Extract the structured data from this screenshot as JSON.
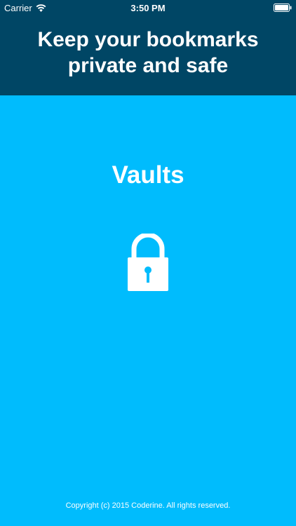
{
  "status_bar": {
    "carrier": "Carrier",
    "time": "3:50 PM"
  },
  "header": {
    "title": "Keep your bookmarks private and safe"
  },
  "main": {
    "title": "Vaults",
    "icon": "lock-icon"
  },
  "footer": {
    "copyright": "Copyright (c) 2015 Coderine. All rights reserved."
  },
  "colors": {
    "header_background": "#004665",
    "main_background": "#00BCFD",
    "text": "#FFFFFF"
  }
}
